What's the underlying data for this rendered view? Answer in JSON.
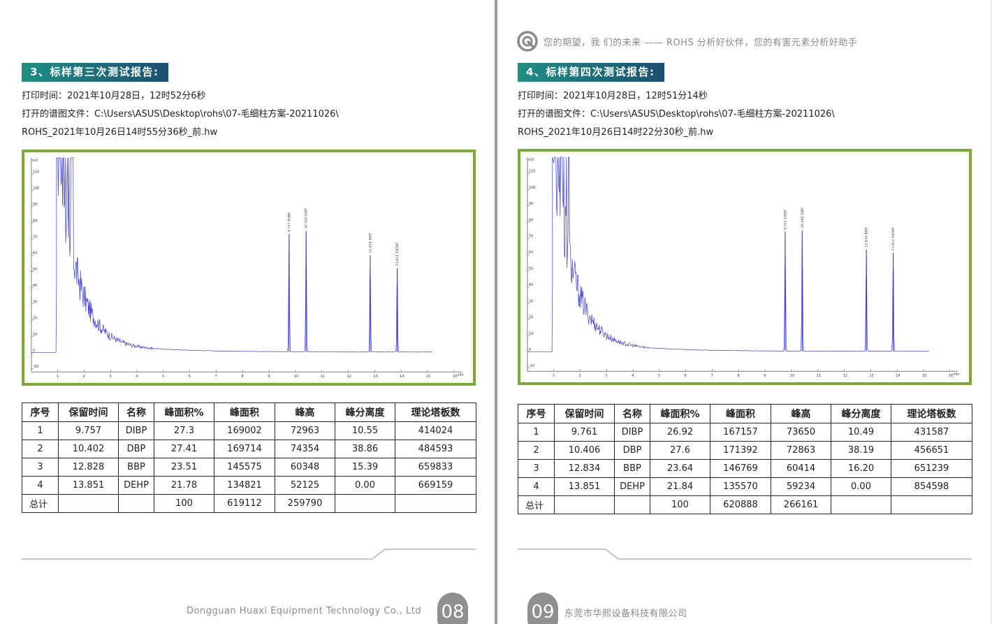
{
  "left": {
    "section_title": "3、标样第三次测试报告:",
    "print_time": "打印时间：2021年10月28日，12时52分6秒",
    "file_line1": "打开的谱图文件：C:\\Users\\ASUS\\Desktop\\rohs\\07-毛细柱方案-20211026\\",
    "file_line2": "ROHS_2021年10月26日14时55分36秒_前.hw",
    "chart_data": {
      "type": "line",
      "ylabel": "mV",
      "xlabel": "min",
      "xlim": [
        0,
        16.3
      ],
      "ylim": [
        -12,
        120
      ],
      "y_ticks": [
        "-10",
        "0",
        "10",
        "20",
        "30",
        "40",
        "50",
        "60",
        "70",
        "80",
        "90",
        "100",
        "110"
      ],
      "x_ticks": [
        "1",
        "2",
        "3",
        "4",
        "5",
        "6",
        "7",
        "8",
        "9",
        "10",
        "11",
        "12",
        "13",
        "14",
        "15",
        "16"
      ],
      "peaks": [
        {
          "label": "9.757 DIBP",
          "t": 9.757,
          "h": 73
        },
        {
          "label": "10.402 DBP",
          "t": 10.402,
          "h": 75
        },
        {
          "label": "12.828 BBP",
          "t": 12.828,
          "h": 60
        },
        {
          "label": "13.851 DEHP",
          "t": 13.851,
          "h": 52
        }
      ]
    },
    "table": {
      "headers": [
        "序号",
        "保留时间",
        "名称",
        "峰面积%",
        "峰面积",
        "峰高",
        "峰分离度",
        "理论塔板数"
      ],
      "rows": [
        [
          "1",
          "9.757",
          "DIBP",
          "27.3",
          "169002",
          "72963",
          "10.55",
          "414024"
        ],
        [
          "2",
          "10.402",
          "DBP",
          "27.41",
          "169714",
          "74354",
          "38.86",
          "484593"
        ],
        [
          "3",
          "12.828",
          "BBP",
          "23.51",
          "145575",
          "60348",
          "15.39",
          "659833"
        ],
        [
          "4",
          "13.851",
          "DEHP",
          "21.78",
          "134821",
          "52125",
          "0.00",
          "669159"
        ]
      ],
      "total_row": [
        "总计",
        "",
        "",
        "100",
        "619112",
        "259790",
        "",
        ""
      ]
    },
    "footer_text": "Dongguan Huaxi Equipment Technology Co., Ltd",
    "page_number": "08"
  },
  "right": {
    "slogan": "您的期望，我 们的未来 —— ROHS 分析好伙伴，您的有害元素分析好助手",
    "section_title": "4、标样第四次测试报告:",
    "print_time": "打印时间：2021年10月28日，12时51分14秒",
    "file_line1": "打开的谱图文件：C:\\Users\\ASUS\\Desktop\\rohs\\07-毛细柱方案-20211026\\",
    "file_line2": "ROHS_2021年10月26日14时22分30秒_前.hw",
    "chart_data": {
      "type": "line",
      "ylabel": "mV",
      "xlabel": "min",
      "xlim": [
        0,
        16.3
      ],
      "ylim": [
        -12,
        120
      ],
      "y_ticks": [
        "-10",
        "0",
        "10",
        "20",
        "30",
        "40",
        "50",
        "60",
        "70",
        "80",
        "90",
        "100",
        "110"
      ],
      "x_ticks": [
        "1",
        "2",
        "3",
        "4",
        "5",
        "6",
        "7",
        "8",
        "9",
        "10",
        "11",
        "12",
        "13",
        "14",
        "15",
        "16"
      ],
      "peaks": [
        {
          "label": "9.761 DIBP",
          "t": 9.761,
          "h": 74
        },
        {
          "label": "10.406 DBP",
          "t": 10.406,
          "h": 75
        },
        {
          "label": "12.834 BBP",
          "t": 12.834,
          "h": 63
        },
        {
          "label": "13.851 DEHP",
          "t": 13.851,
          "h": 61
        }
      ]
    },
    "table": {
      "headers": [
        "序号",
        "保留时间",
        "名称",
        "峰面积%",
        "峰面积",
        "峰高",
        "峰分离度",
        "理论塔板数"
      ],
      "rows": [
        [
          "1",
          "9.761",
          "DIBP",
          "26.92",
          "167157",
          "73650",
          "10.49",
          "431587"
        ],
        [
          "2",
          "10.406",
          "DBP",
          "27.6",
          "171392",
          "72863",
          "38.19",
          "456651"
        ],
        [
          "3",
          "12.834",
          "BBP",
          "23.64",
          "146769",
          "60414",
          "16.20",
          "651239"
        ],
        [
          "4",
          "13.851",
          "DEHP",
          "21.84",
          "135570",
          "59234",
          "0.00",
          "854598"
        ]
      ],
      "total_row": [
        "总计",
        "",
        "",
        "100",
        "620888",
        "266161",
        "",
        ""
      ]
    },
    "footer_text": "东莞市华熙设备科技有限公司",
    "page_number": "09"
  },
  "colors": {
    "title_gradient_start": "#1f8f85",
    "title_gradient_end": "#1b4f70",
    "chart_frame": "#7da83a",
    "trace": "#3a3ae0",
    "page_number_bg": "#8f8f8f"
  }
}
